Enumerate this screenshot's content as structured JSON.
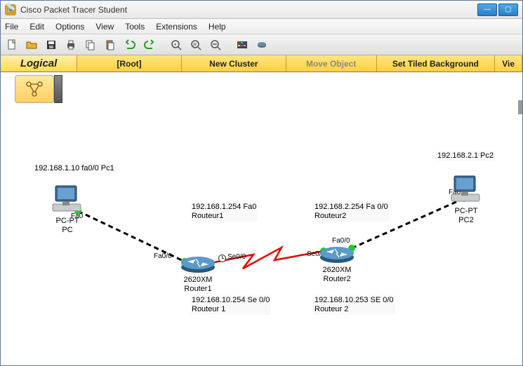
{
  "window": {
    "title": "Cisco Packet Tracer Student"
  },
  "menu": {
    "file": "File",
    "edit": "Edit",
    "options": "Options",
    "view": "View",
    "tools": "Tools",
    "extensions": "Extensions",
    "help": "Help"
  },
  "nav": {
    "logical": "Logical",
    "root": "[Root]",
    "newcluster": "New Cluster",
    "moveobj": "Move Object",
    "tiled": "Set Tiled Background",
    "viewport": "Vie"
  },
  "labels": {
    "pc1_ip": "192.168.1.10 fa0/0 Pc1",
    "pc2_ip": "192.168.2.1 Pc2",
    "r1_fa": "192.168.1.254 Fa0\nRouteur1",
    "r2_fa": "192.168.2.254 Fa 0/0\nRouteur2",
    "r1_se": "192.168.10.254 Se 0/0\nRouteur 1",
    "r2_se": "192.168.10.253 SE 0/0\nRouteur 2",
    "if_pc1": "Fa0",
    "if_pc2": "Fa0",
    "if_r1fa": "Fa0/0",
    "if_r1se": "Se0/0",
    "if_r2fa": "Fa0/0",
    "if_r2se": "Se0/0"
  },
  "devices": {
    "pc1": {
      "model": "PC-PT",
      "name": "PC"
    },
    "pc2": {
      "model": "PC-PT",
      "name": "PC2"
    },
    "r1": {
      "model": "2620XM",
      "name": "Router1"
    },
    "r2": {
      "model": "2620XM",
      "name": "Router2"
    }
  }
}
